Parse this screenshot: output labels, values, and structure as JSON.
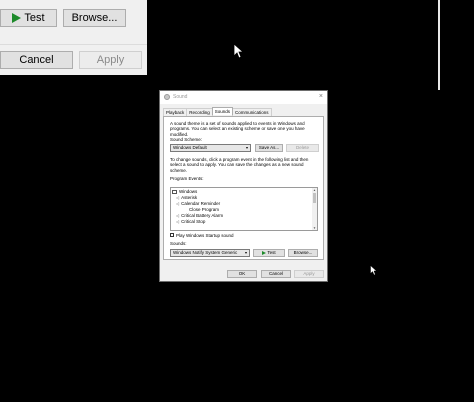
{
  "background_dialog": {
    "test_label": "Test",
    "browse_label": "Browse...",
    "cancel_label": "Cancel",
    "apply_label": "Apply"
  },
  "sound_dialog": {
    "title": "Sound",
    "tabs": [
      "Playback",
      "Recording",
      "Sounds",
      "Communications"
    ],
    "active_tab": "Sounds",
    "intro_text": "A sound theme is a set of sounds applied to events in Windows and programs. You can select an existing scheme or save one you have modified.",
    "scheme_label": "Sound Scheme:",
    "scheme_value": "Windows Default",
    "save_as_label": "Save As...",
    "delete_label": "Delete",
    "change_text": "To change sounds, click a program event in the following list and then select a sound to apply. You can save the changes as a new sound scheme.",
    "program_events_label": "Program Events:",
    "events": [
      {
        "label": "Windows",
        "kind": "group"
      },
      {
        "label": "Asterisk",
        "kind": "sound"
      },
      {
        "label": "Calendar Reminder",
        "kind": "sound"
      },
      {
        "label": "Close Program",
        "kind": "plain"
      },
      {
        "label": "Critical Battery Alarm",
        "kind": "sound"
      },
      {
        "label": "Critical Stop",
        "kind": "sound"
      }
    ],
    "startup_checkbox_label": "Play Windows Startup sound",
    "startup_checked": false,
    "sounds_label": "Sounds:",
    "sound_value": "Windows Notify System Generic",
    "test_label": "Test",
    "browse_label": "Browse...",
    "ok_label": "OK",
    "cancel_label": "Cancel",
    "apply_label": "Apply"
  },
  "colors": {
    "desktop": "#000000",
    "dialog_bg": "#f0f0f0",
    "play_green": "#1d8a2a"
  }
}
